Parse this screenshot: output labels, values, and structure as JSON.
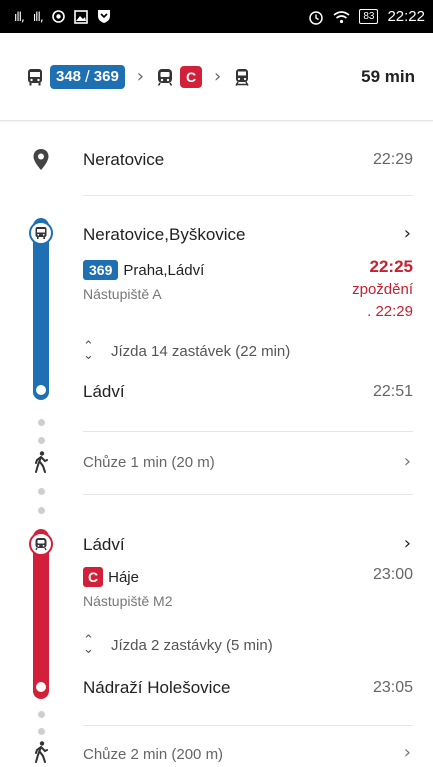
{
  "status_bar": {
    "signal_1": "ıll,",
    "signal_2": "ıll,",
    "battery": "83",
    "time": "22:22",
    "icons": [
      "signal-icon",
      "signal-icon",
      "location-icon",
      "image-icon",
      "shield-icon",
      "alarm-icon",
      "wifi-icon",
      "battery-icon"
    ]
  },
  "route": {
    "bus_lines": [
      "348",
      "369"
    ],
    "separator": "/",
    "metro_line": "C",
    "duration": "59 min"
  },
  "origin": {
    "name": "Neratovice",
    "time": "22:29"
  },
  "leg1": {
    "stop": "Neratovice,Byškovice",
    "line": "369",
    "direction": "Praha,Ládví",
    "platform": "Nástupiště A",
    "time": "22:25",
    "delay_label": "zpoždění",
    "delay_time": ". 22:29",
    "ride": "Jízda 14 zastávek (22 min)",
    "end_stop": "Ládví",
    "end_time": "22:51",
    "color": "#1f6fb3"
  },
  "walk1": {
    "label": "Chůze 1 min (20 m)"
  },
  "leg2": {
    "stop": "Ládví",
    "line": "C",
    "direction": "Háje",
    "platform": "Nástupiště M2",
    "time": "23:00",
    "ride": "Jízda 2 zastávky (5 min)",
    "end_stop": "Nádraží Holešovice",
    "end_time": "23:05",
    "color": "#d3203a"
  },
  "walk2": {
    "label": "Chůze 2 min (200 m)"
  }
}
